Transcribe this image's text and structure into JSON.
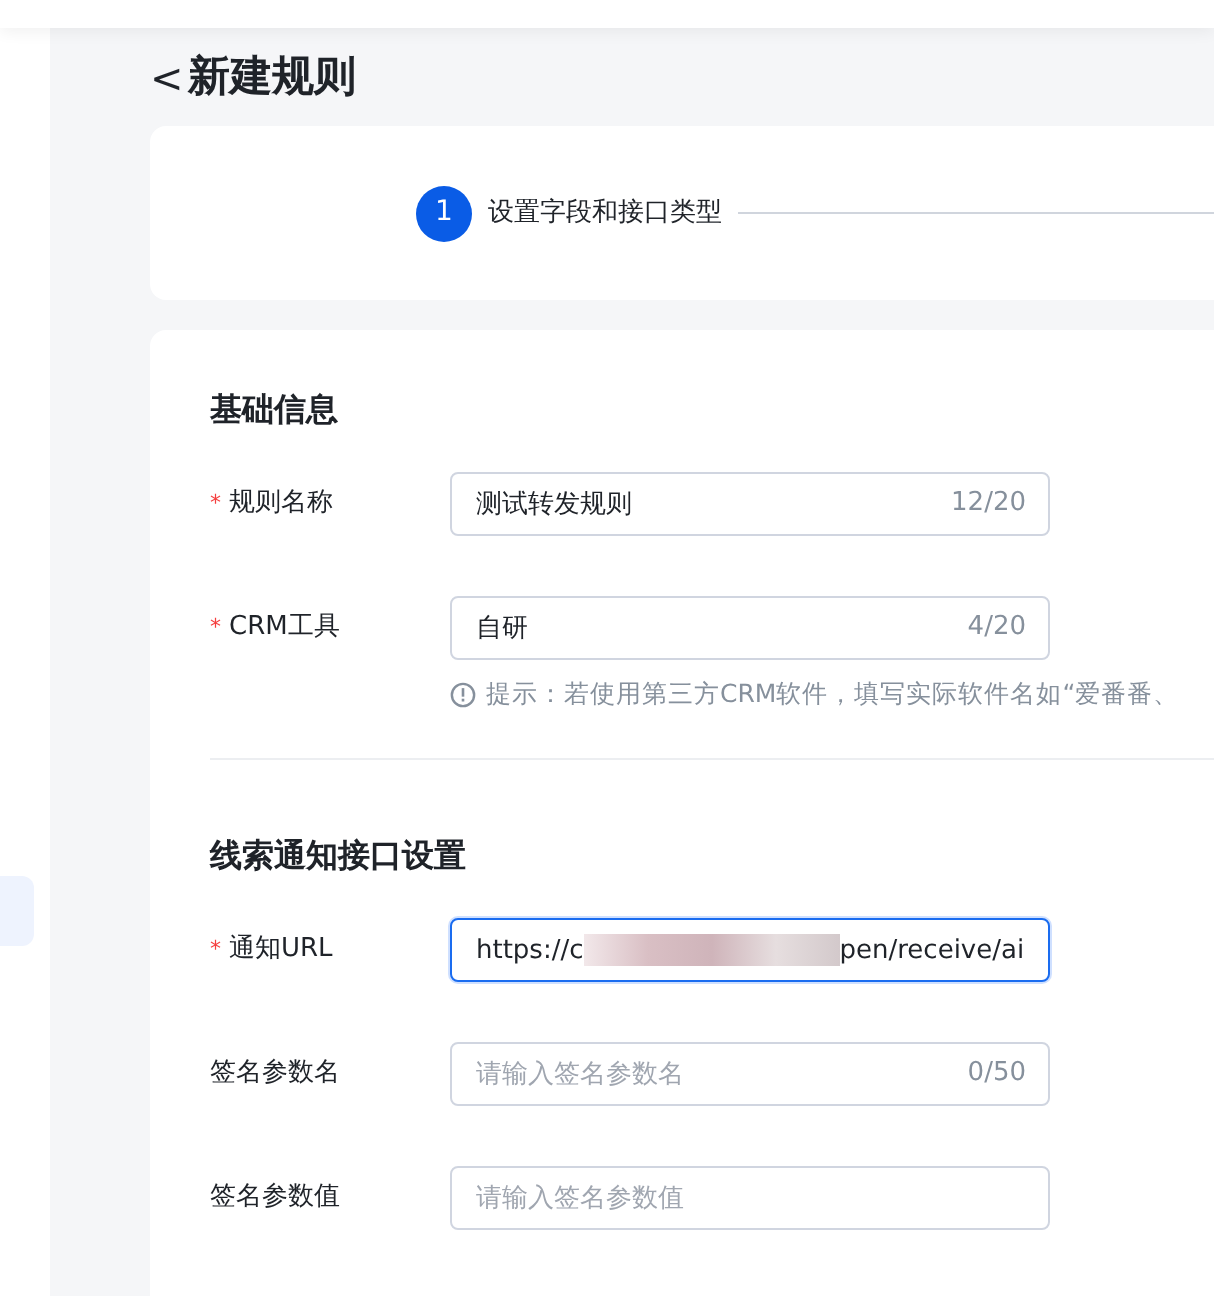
{
  "sidebar": {
    "items": [
      {
        "selected": true
      }
    ]
  },
  "page": {
    "back": "<",
    "title": "新建规则"
  },
  "steps": [
    {
      "number": "1",
      "label": "设置字段和接口类型",
      "selected": true
    }
  ],
  "sections": [
    {
      "title": "基础信息",
      "fields": [
        {
          "label": "规则名称",
          "required": true,
          "mark": "*",
          "value": "测试转发规则",
          "count": "12/20"
        },
        {
          "label": "CRM工具",
          "required": true,
          "mark": "*",
          "value": "自研",
          "count": "4/20",
          "hint": "提示：若使用第三方CRM软件，填写实际软件名如“爱番番、"
        }
      ]
    },
    {
      "title": "线索通知接口设置",
      "fields": [
        {
          "label": "通知URL",
          "required": true,
          "mark": "*",
          "value_start": "https://c",
          "value_end": "pen/receive/ai",
          "redacted": true,
          "focused": true
        },
        {
          "label": "签名参数名",
          "required": false,
          "placeholder": "请输入签名参数名",
          "count": "0/50"
        },
        {
          "label": "签名参数值",
          "required": false,
          "placeholder": "请输入签名参数值"
        }
      ]
    }
  ]
}
